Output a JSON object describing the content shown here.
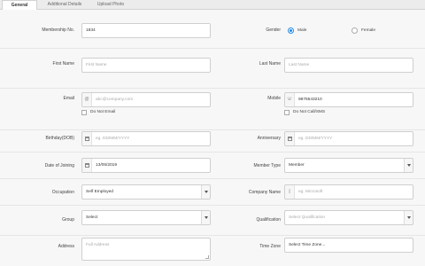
{
  "tabs": [
    {
      "label": "General",
      "active": true
    },
    {
      "label": "Additional Details",
      "active": false
    },
    {
      "label": "Upload Photo",
      "active": false
    }
  ],
  "form": {
    "membership_no": {
      "label": "Membership No.",
      "value": "1834"
    },
    "gender": {
      "label": "Gender",
      "options": [
        "Male",
        "Female"
      ],
      "selected": "Male"
    },
    "first_name": {
      "label": "First Name",
      "placeholder": "First Name"
    },
    "last_name": {
      "label": "Last Name",
      "placeholder": "Last Name"
    },
    "email": {
      "label": "Email",
      "placeholder": "abc@company.com",
      "icon": "at-icon",
      "checkbox_label": "Do Not Email"
    },
    "mobile": {
      "label": "Mobile",
      "value": "9876543210",
      "icon": "phone-icon",
      "checkbox_label": "Do Not Call/SMS"
    },
    "birthday": {
      "label": "Birthday(DOB)",
      "placeholder": "eg. DD/MM/YYYY",
      "icon": "calendar-icon"
    },
    "anniversary": {
      "label": "Anniversary",
      "placeholder": "eg. DD/MM/YYYY",
      "icon": "calendar-icon"
    },
    "date_of_joining": {
      "label": "Date of Joining",
      "value": "13/05/2019",
      "icon": "calendar-icon"
    },
    "member_type": {
      "label": "Member Type",
      "value": "Member"
    },
    "occupation": {
      "label": "Occupation",
      "value": "Self Employed"
    },
    "company_name": {
      "label": "Company Name",
      "placeholder": "eg. Microsoft",
      "icon": "building-icon"
    },
    "group": {
      "label": "Group",
      "value": "Select"
    },
    "qualification": {
      "label": "Qualification",
      "value": "Select Qualification"
    },
    "address": {
      "label": "Address",
      "placeholder": "Full Address"
    },
    "time_zone": {
      "label": "Time Zone",
      "value": "Select Time Zone..."
    }
  },
  "colors": {
    "accent": "#1e88e5",
    "panel": "#f7f7f7",
    "tabbar": "#ececec"
  }
}
